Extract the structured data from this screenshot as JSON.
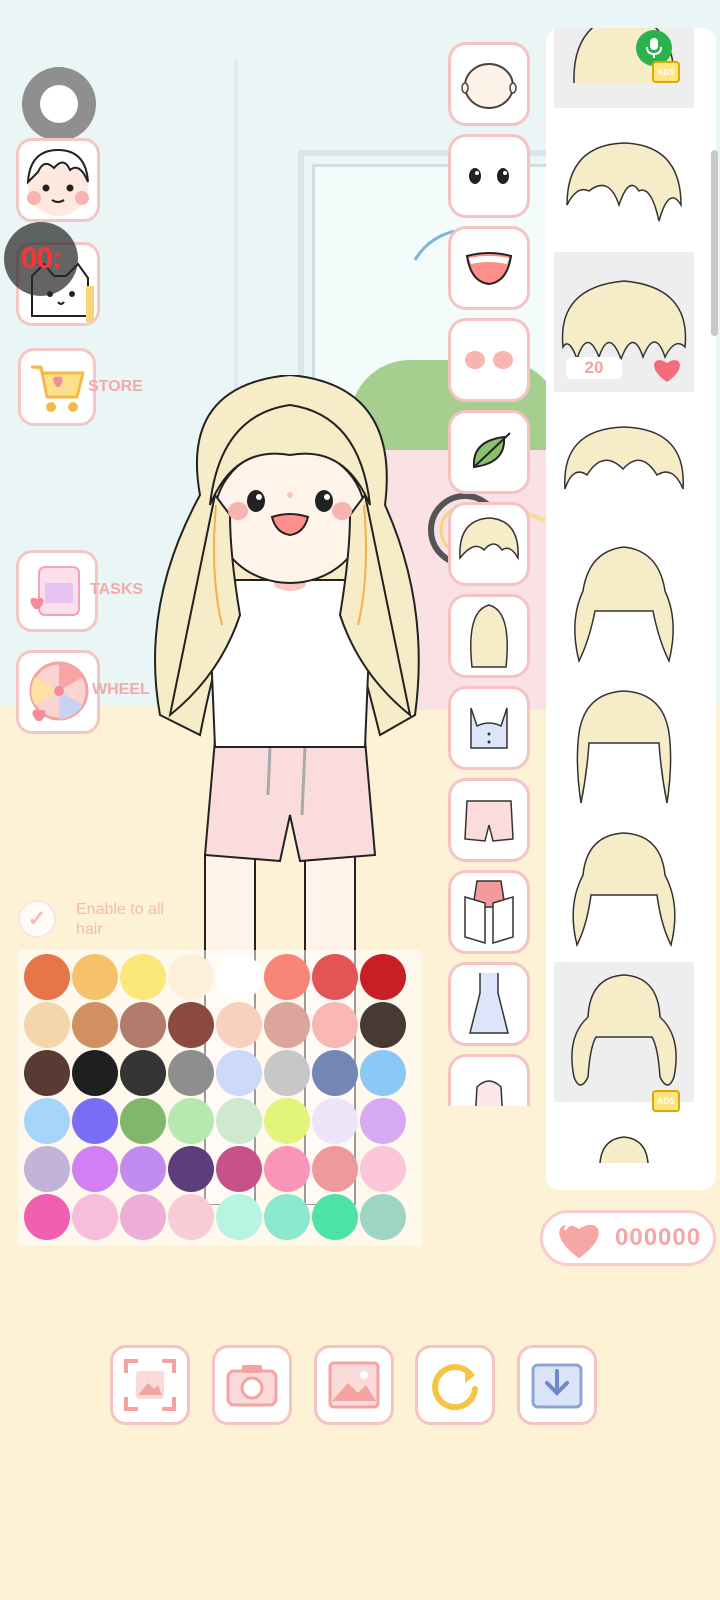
{
  "sidebar": {
    "store_label": "STORE",
    "tasks_label": "TASKS",
    "wheel_label": "WHEEL",
    "timer_text": "00:"
  },
  "categories": [
    {
      "name": "head",
      "icon": "head-icon"
    },
    {
      "name": "eyes",
      "icon": "eyes-icon"
    },
    {
      "name": "mouth",
      "icon": "mouth-icon"
    },
    {
      "name": "blush",
      "icon": "blush-icon"
    },
    {
      "name": "leaf",
      "icon": "leaf-icon"
    },
    {
      "name": "hair",
      "icon": "hair-icon",
      "selected": true
    },
    {
      "name": "back-hair",
      "icon": "long-hair-icon"
    },
    {
      "name": "top",
      "icon": "crop-top-icon"
    },
    {
      "name": "bottom",
      "icon": "shorts-icon"
    },
    {
      "name": "jacket",
      "icon": "jacket-icon"
    },
    {
      "name": "dress",
      "icon": "dress-icon"
    },
    {
      "name": "outer",
      "icon": "coat-icon"
    }
  ],
  "hair_list": {
    "price_label": "20",
    "ads_label": "ADS"
  },
  "palette": {
    "enable_label": "Enable to all hair",
    "colors": [
      "#e8744a",
      "#f5c26b",
      "#fbe77a",
      "#fdf0d8",
      "#ffffff",
      "#f98478",
      "#e25554",
      "#c81f26",
      "#f3d6ac",
      "#d09060",
      "#b17a6b",
      "#8a4a42",
      "#f9d0c0",
      "#dba59c",
      "#f9b8b4",
      "#463a33",
      "#5a3b34",
      "#1f1f1f",
      "#353535",
      "#8e8e8e",
      "#cdd9f8",
      "#c7c7c7",
      "#7486b6",
      "#8ac8f6",
      "#a5d5fb",
      "#7a6ef6",
      "#7fb86c",
      "#b6e8b0",
      "#cfe8d0",
      "#e2f57a",
      "#ece4f8",
      "#d8a9f3",
      "#c2b3d8",
      "#d080f2",
      "#c18cf0",
      "#5e3d7c",
      "#c75288",
      "#f995b6",
      "#f0999a",
      "#fbc6d8",
      "#f160b0",
      "#f8bddb",
      "#ecaed6",
      "#f8ccd6",
      "#b8f4e2",
      "#8ce8cc",
      "#4de2a8",
      "#a0d4c2"
    ]
  },
  "currency": {
    "value": "000000"
  },
  "toolbar": [
    {
      "name": "fullscreen",
      "icon": "fullscreen-icon"
    },
    {
      "name": "camera",
      "icon": "camera-icon"
    },
    {
      "name": "background",
      "icon": "background-icon"
    },
    {
      "name": "reset",
      "icon": "refresh-icon"
    },
    {
      "name": "save",
      "icon": "download-icon"
    }
  ],
  "colors": {
    "accent_pink": "#f5a7a7",
    "tile_border": "#f5c3c3",
    "hair_blonde": "#f7ecc8",
    "floor": "#fdf1d6",
    "wall": "#eaf6f5"
  }
}
